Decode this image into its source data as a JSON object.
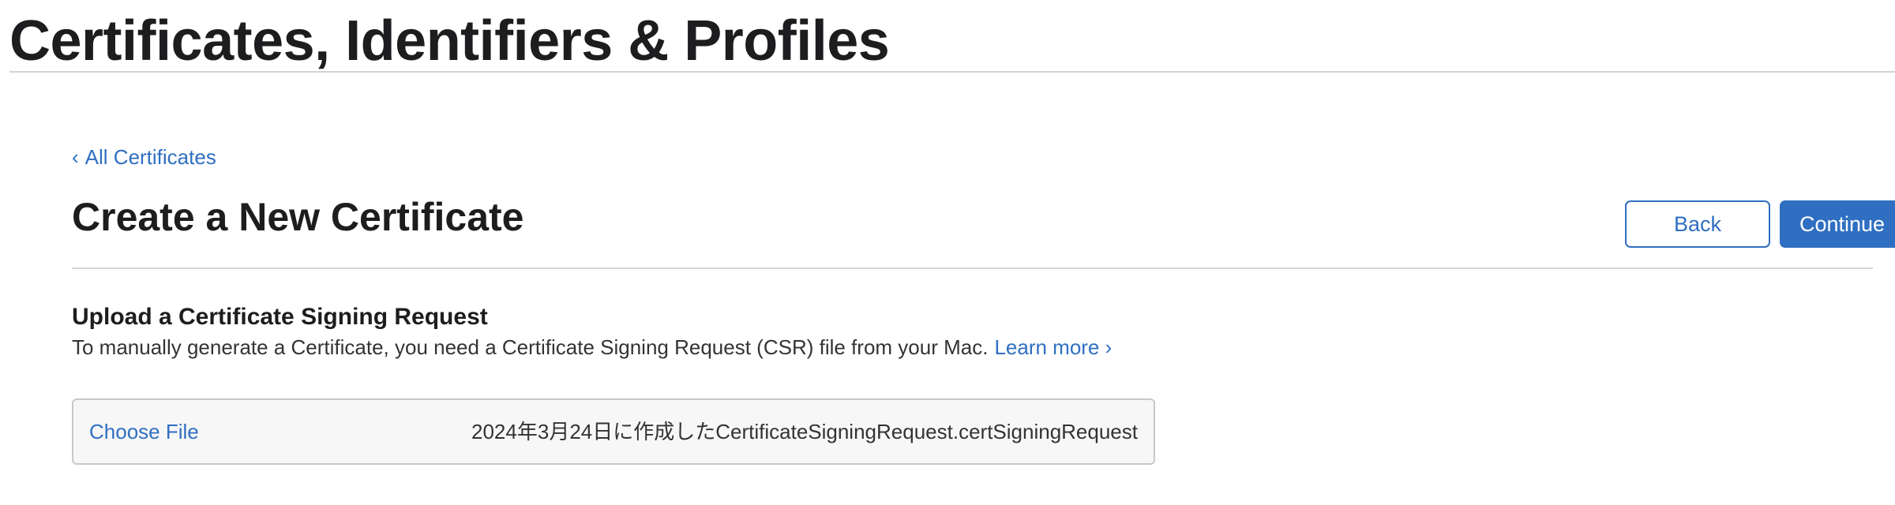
{
  "header": {
    "title": "Certificates, Identifiers & Profiles"
  },
  "nav": {
    "back_chevron": "‹",
    "back_link_label": "All Certificates"
  },
  "main": {
    "title": "Create a New Certificate",
    "back_button_label": "Back",
    "continue_button_label": "Continue"
  },
  "upload": {
    "title": "Upload a Certificate Signing Request",
    "description": "To manually generate a Certificate, you need a Certificate Signing Request (CSR) file from your Mac.",
    "learn_more_label": "Learn more ›",
    "choose_file_label": "Choose File",
    "selected_file_name": "2024年3月24日に作成したCertificateSigningRequest.certSigningRequest"
  },
  "colors": {
    "accent": "#2f6fc2",
    "text_primary": "#1d1d1f",
    "divider": "#d2d2d7"
  },
  "icons": {
    "back_chevron": "chevron-left-icon"
  }
}
